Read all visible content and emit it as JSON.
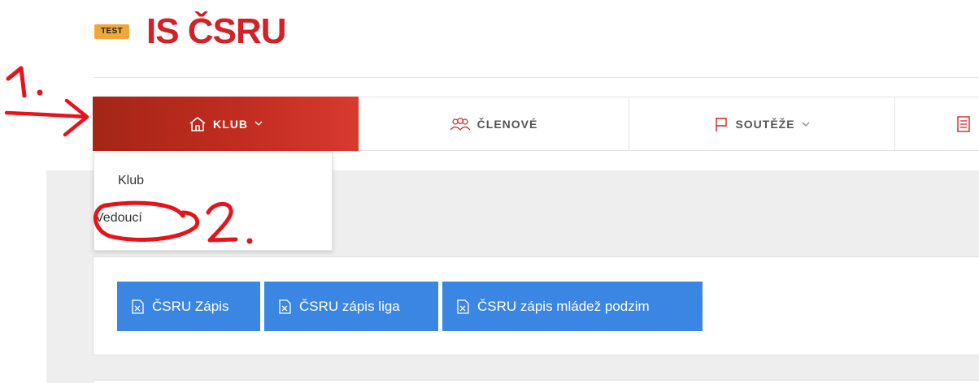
{
  "header": {
    "badge": "TEST",
    "title": "IS ČSRU"
  },
  "nav": {
    "items": [
      {
        "label": "KLUB",
        "icon": "home-icon",
        "has_dropdown": true,
        "active": true
      },
      {
        "label": "ČLENOVÉ",
        "icon": "people-icon",
        "has_dropdown": false,
        "active": false
      },
      {
        "label": "SOUTĚŽE",
        "icon": "flag-icon",
        "has_dropdown": true,
        "active": false
      },
      {
        "label": "",
        "icon": "document-icon",
        "has_dropdown": false,
        "active": false
      }
    ]
  },
  "dropdown": {
    "items": [
      {
        "label": "Klub"
      },
      {
        "label": "Vedoucí"
      }
    ]
  },
  "buttons": [
    {
      "label": "ČSRU Zápis",
      "icon": "excel-icon"
    },
    {
      "label": "ČSRU zápis liga",
      "icon": "excel-icon"
    },
    {
      "label": "ČSRU zápis mládež podzim",
      "icon": "excel-icon"
    }
  ],
  "annotations": {
    "step1": "1.",
    "step2": "2."
  },
  "colors": {
    "brand_red": "#d42027",
    "active_nav_start": "#a32616",
    "active_nav_end": "#d83a2e",
    "button_blue": "#3b86e3",
    "badge_orange": "#f0a73a",
    "annotation_red": "#e8131a"
  }
}
